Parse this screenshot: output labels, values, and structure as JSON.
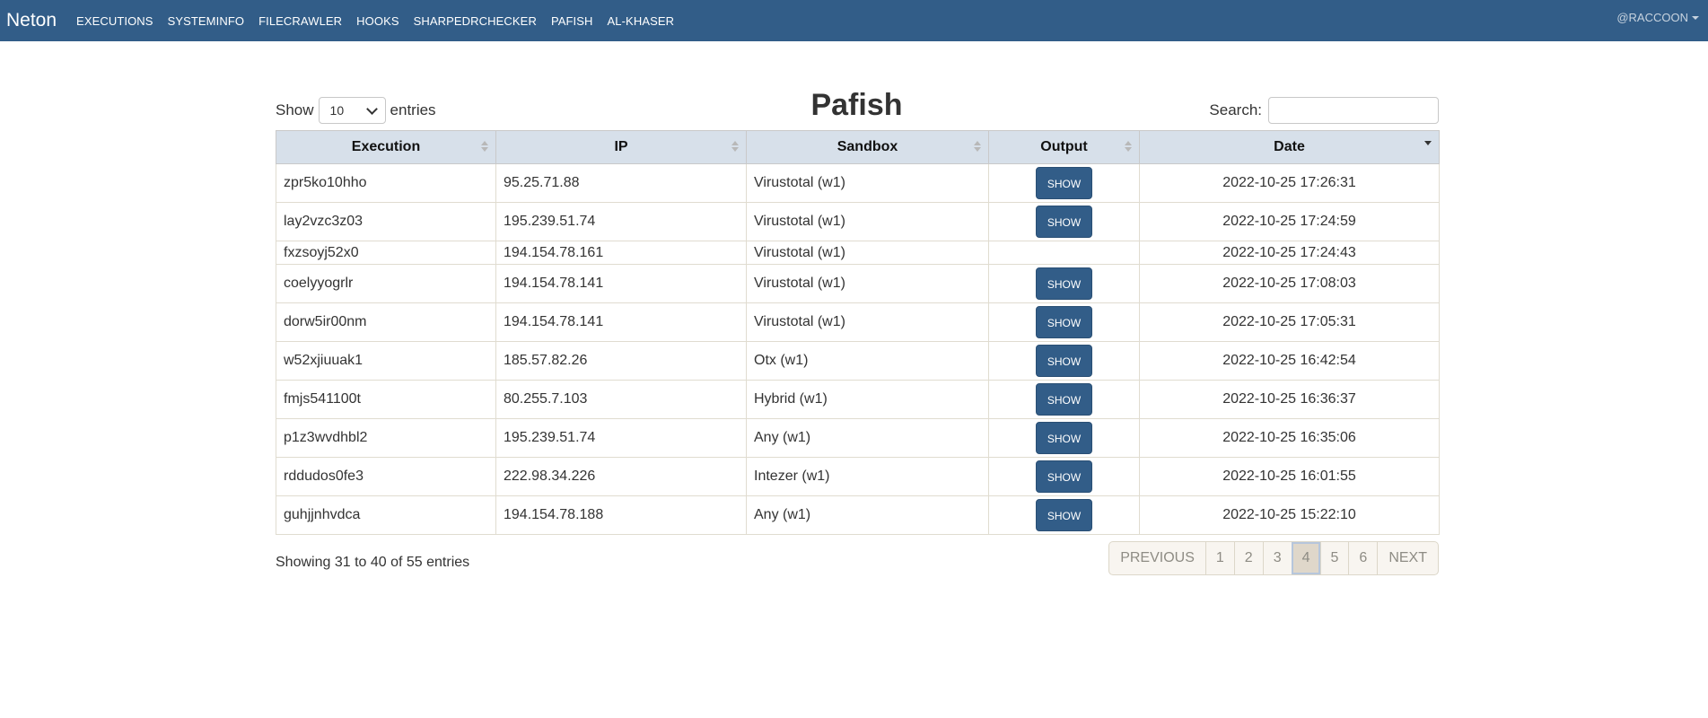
{
  "navbar": {
    "brand": "Neton",
    "links": [
      "EXECUTIONS",
      "SYSTEMINFO",
      "FILECRAWLER",
      "HOOKS",
      "SHARPEDRCHECKER",
      "PAFISH",
      "AL-KHASER"
    ],
    "user": "@RACCOON"
  },
  "page": {
    "title": "Pafish",
    "show_label": "Show",
    "entries_label": "entries",
    "length_value": "10",
    "search_label": "Search:",
    "search_value": ""
  },
  "table": {
    "columns": [
      "Execution",
      "IP",
      "Sandbox",
      "Output",
      "Date"
    ],
    "sorted_column": "Date",
    "rows": [
      {
        "execution": "zpr5ko10hho",
        "ip": "95.25.71.88",
        "sandbox": "Virustotal (w1)",
        "output": "SHOW",
        "date": "2022-10-25 17:26:31"
      },
      {
        "execution": "lay2vzc3z03",
        "ip": "195.239.51.74",
        "sandbox": "Virustotal (w1)",
        "output": "SHOW",
        "date": "2022-10-25 17:24:59"
      },
      {
        "execution": "fxzsoyj52x0",
        "ip": "194.154.78.161",
        "sandbox": "Virustotal (w1)",
        "output": "",
        "date": "2022-10-25 17:24:43"
      },
      {
        "execution": "coelyyogrlr",
        "ip": "194.154.78.141",
        "sandbox": "Virustotal (w1)",
        "output": "SHOW",
        "date": "2022-10-25 17:08:03"
      },
      {
        "execution": "dorw5ir00nm",
        "ip": "194.154.78.141",
        "sandbox": "Virustotal (w1)",
        "output": "SHOW",
        "date": "2022-10-25 17:05:31"
      },
      {
        "execution": "w52xjiuuak1",
        "ip": "185.57.82.26",
        "sandbox": "Otx (w1)",
        "output": "SHOW",
        "date": "2022-10-25 16:42:54"
      },
      {
        "execution": "fmjs541100t",
        "ip": "80.255.7.103",
        "sandbox": "Hybrid (w1)",
        "output": "SHOW",
        "date": "2022-10-25 16:36:37"
      },
      {
        "execution": "p1z3wvdhbl2",
        "ip": "195.239.51.74",
        "sandbox": "Any (w1)",
        "output": "SHOW",
        "date": "2022-10-25 16:35:06"
      },
      {
        "execution": "rddudos0fe3",
        "ip": "222.98.34.226",
        "sandbox": "Intezer (w1)",
        "output": "SHOW",
        "date": "2022-10-25 16:01:55"
      },
      {
        "execution": "guhjjnhvdca",
        "ip": "194.154.78.188",
        "sandbox": "Any (w1)",
        "output": "SHOW",
        "date": "2022-10-25 15:22:10"
      }
    ]
  },
  "footer": {
    "info": "Showing 31 to 40 of 55 entries",
    "pagination": {
      "previous": "PREVIOUS",
      "pages": [
        "1",
        "2",
        "3",
        "4",
        "5",
        "6"
      ],
      "active": "4",
      "next": "NEXT"
    }
  },
  "colors": {
    "navbar": "#325d88",
    "header_bg": "#d7e0ea",
    "button": "#325d88"
  }
}
